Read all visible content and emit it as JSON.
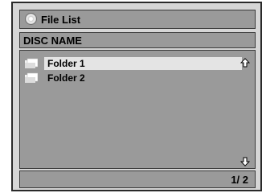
{
  "window": {
    "title": "File List",
    "disc_name": "DISC NAME"
  },
  "list": {
    "items": [
      {
        "label": "Folder 1",
        "selected": true
      },
      {
        "label": "Folder 2",
        "selected": false
      }
    ]
  },
  "footer": {
    "page": "1/ 2"
  },
  "icons": {
    "title": "disc-icon",
    "folder": "folder-icon",
    "scroll_up": "arrow-up-icon",
    "scroll_down": "arrow-down-icon"
  },
  "colors": {
    "panel": "#9a9a9a",
    "frame": "#d6d6d6",
    "selected_row": "#e4e4e4"
  }
}
